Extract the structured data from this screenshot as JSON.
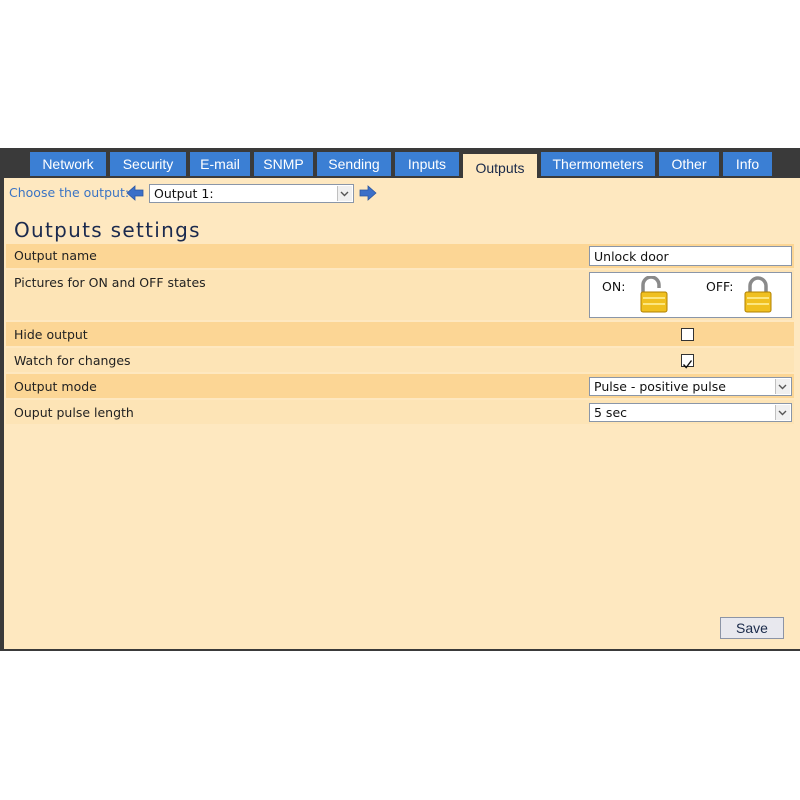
{
  "tabs": [
    "Network",
    "Security",
    "E-mail",
    "SNMP",
    "Sending",
    "Inputs",
    "Outputs",
    "Thermometers",
    "Other",
    "Info"
  ],
  "active_tab": "Outputs",
  "chooser": {
    "label": "Choose the output:",
    "selected": "Output 1:"
  },
  "title": "Outputs settings",
  "rows": {
    "output_name": {
      "label": "Output name",
      "value": "Unlock door"
    },
    "pictures": {
      "label": "Pictures for ON and OFF states",
      "on_label": "ON:",
      "off_label": "OFF:"
    },
    "hide_output": {
      "label": "Hide output",
      "checked": false
    },
    "watch_changes": {
      "label": "Watch for changes",
      "checked": true
    },
    "output_mode": {
      "label": "Output mode",
      "value": "Pulse - positive pulse"
    },
    "pulse_length": {
      "label": "Ouput pulse length",
      "value": "5 sec"
    }
  },
  "save_label": "Save",
  "colors": {
    "tab_blue": "#3b7fd4",
    "panel": "#fee8c0",
    "row_dark": "#fcd695",
    "row_light": "#fde4b6",
    "frame": "#3a3a3a"
  },
  "icons": [
    "arrow-left-icon",
    "arrow-right-icon",
    "unlocked-padlock-icon",
    "locked-padlock-icon",
    "chevron-down-icon",
    "checkmark-icon"
  ]
}
